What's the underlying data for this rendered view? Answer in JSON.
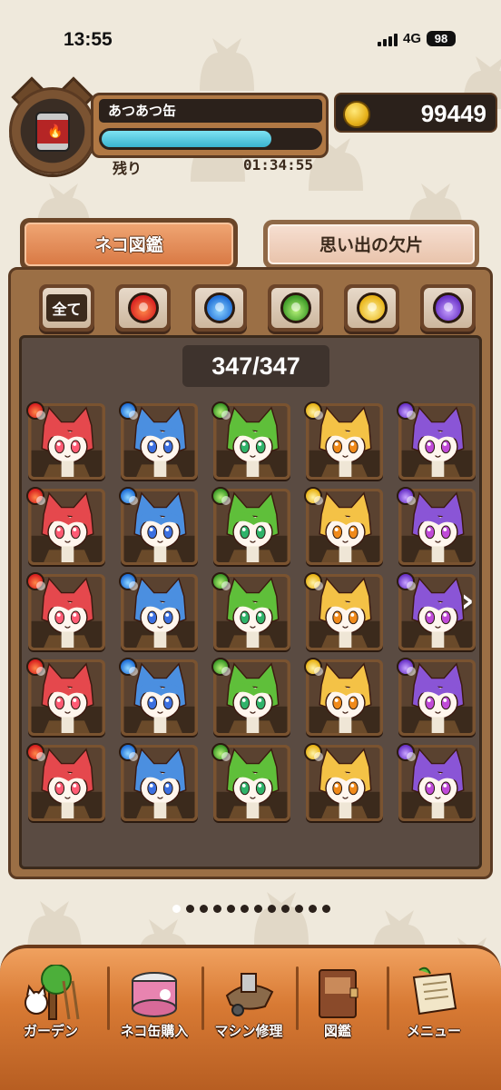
{
  "status_bar": {
    "time": "13:55",
    "network": "4G",
    "battery": "98"
  },
  "header": {
    "can_name": "あつあつ缶",
    "remaining_label": "残り",
    "remaining_time": "01:34:55",
    "progress_fraction": 0.78,
    "coins": "99449"
  },
  "tabs": [
    {
      "label": "ネコ図鑑",
      "active": true
    },
    {
      "label": "思い出の欠片",
      "active": false
    }
  ],
  "filters": [
    {
      "label": "全て",
      "icon": "all"
    },
    {
      "icon": "fire-element-icon"
    },
    {
      "icon": "water-element-icon"
    },
    {
      "icon": "wood-element-icon"
    },
    {
      "icon": "light-element-icon"
    },
    {
      "icon": "dark-element-icon"
    }
  ],
  "collection": {
    "count": "347/347",
    "columns": [
      "fire",
      "water",
      "wood",
      "light",
      "dark"
    ],
    "rows": 5,
    "page_total": 12,
    "page_current": 1
  },
  "colors": {
    "fire": "#e5484d",
    "water": "#4b8fe0",
    "wood": "#5fbf3a",
    "light": "#f4c246",
    "dark": "#8a55d6"
  },
  "bottom_nav": [
    {
      "label": "ガーデン",
      "icon": "garden-icon"
    },
    {
      "label": "ネコ缶購入",
      "icon": "cat-can-icon"
    },
    {
      "label": "マシン修理",
      "icon": "airship-icon"
    },
    {
      "label": "図鑑",
      "icon": "book-icon"
    },
    {
      "label": "メニュー",
      "icon": "scroll-menu-icon"
    }
  ]
}
